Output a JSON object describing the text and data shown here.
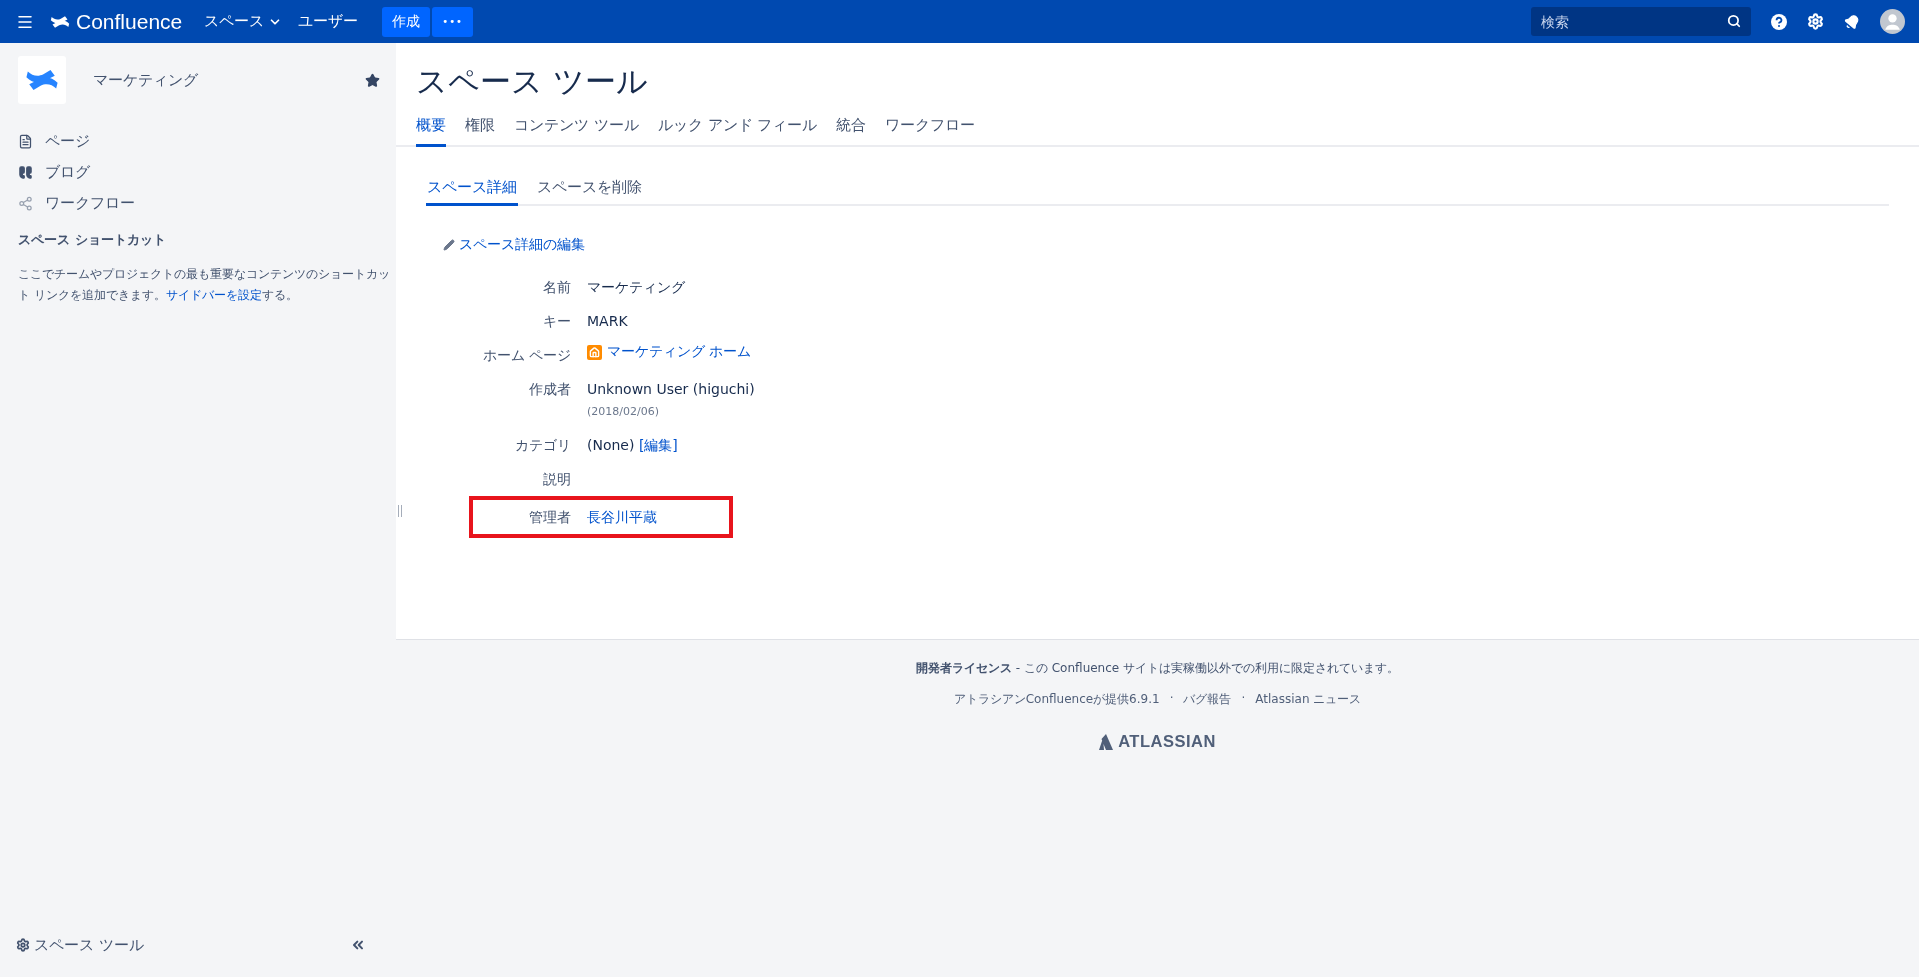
{
  "header": {
    "app_name": "Confluence",
    "nav": [
      {
        "label": "スペース",
        "dropdown": true
      },
      {
        "label": "ユーザー",
        "dropdown": false
      }
    ],
    "create_button": "作成",
    "more_button": "•••",
    "search": {
      "placeholder": "検索"
    }
  },
  "sidebar": {
    "space_name": "マーケティング",
    "starred": true,
    "nav": [
      {
        "label": "ページ",
        "kind": "page"
      },
      {
        "label": "ブログ",
        "kind": "blog"
      },
      {
        "label": "ワークフロー",
        "kind": "workflow"
      }
    ],
    "shortcuts": {
      "title": "スペース ショートカット",
      "text": "ここでチームやプロジェクトの最も重要なコンテンツのショートカット リンクを追加できます。",
      "link": "サイドバーを設定",
      "text_after": "する。"
    },
    "tools_label": "スペース ツール"
  },
  "page": {
    "title": "スペース ツール",
    "tabs": [
      {
        "label": "概要",
        "selected": true
      },
      {
        "label": "権限",
        "selected": false
      },
      {
        "label": "コンテンツ ツール",
        "selected": false
      },
      {
        "label": "ルック アンド フィール",
        "selected": false
      },
      {
        "label": "統合",
        "selected": false
      },
      {
        "label": "ワークフロー",
        "selected": false
      }
    ],
    "subtabs": [
      {
        "label": "スペース詳細",
        "selected": true
      },
      {
        "label": "スペースを削除",
        "selected": false
      }
    ],
    "edit_link": "スペース詳細の編集",
    "details": [
      {
        "label": "名前",
        "value": "マーケティング",
        "kind": "text",
        "highlighted": false
      },
      {
        "label": "キー",
        "value": "MARK",
        "kind": "text",
        "highlighted": false
      },
      {
        "label": "ホーム ページ",
        "value": "マーケティング ホーム",
        "kind": "page_link",
        "highlighted": false
      },
      {
        "label": "作成者",
        "value": "Unknown User (higuchi)",
        "note": "(2018/02/06)",
        "kind": "text",
        "highlighted": false
      },
      {
        "label": "カテゴリ",
        "value": "(None)",
        "link": "[編集]",
        "kind": "text",
        "highlighted": false
      },
      {
        "label": "説明",
        "highlighted": false
      },
      {
        "label": "管理者",
        "value": "長谷川平蔵",
        "kind": "link",
        "highlighted": true
      }
    ]
  },
  "footer": {
    "license": "**開発者ライセンス** - この Confluence サイトは実稼働以外での利用に限定されています。",
    "links": [
      "アトラシアンConfluenceが提供6.9.1",
      "バグ報告",
      "Atlassian ニュース"
    ],
    "separator": "·",
    "logo": "ATLASSIAN"
  }
}
